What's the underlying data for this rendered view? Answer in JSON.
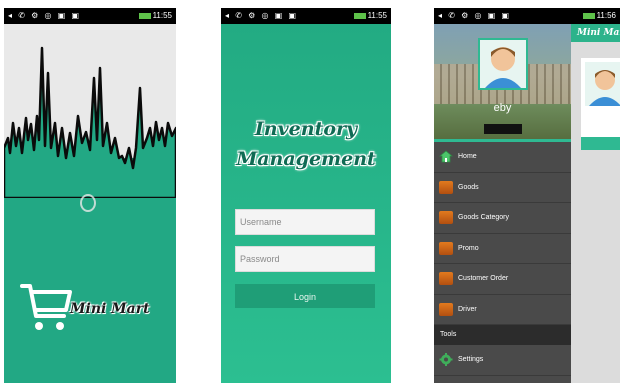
{
  "screens": {
    "splash": {
      "status_time": "11:55",
      "brand": "Mini Mart"
    },
    "login": {
      "status_time": "11:55",
      "title_line1": "Inventory",
      "title_line2": "Management",
      "username_placeholder": "Username",
      "password_placeholder": "Password",
      "login_label": "Login"
    },
    "drawer": {
      "status_time": "11:56",
      "user_name": "eby",
      "app_title": "Mini Mart",
      "menu": [
        {
          "label": "Home",
          "icon": "home-icon"
        },
        {
          "label": "Goods",
          "icon": "box-icon"
        },
        {
          "label": "Goods Category",
          "icon": "box-icon"
        },
        {
          "label": "Promo",
          "icon": "box-icon"
        },
        {
          "label": "Customer Order",
          "icon": "box-icon"
        },
        {
          "label": "Driver",
          "icon": "box-icon"
        }
      ],
      "section_label": "Tools",
      "settings_label": "Settings"
    }
  },
  "colors": {
    "primary_green": "#22a884",
    "accent_green": "#2fb992",
    "drawer_bg": "#4a4a4a"
  }
}
